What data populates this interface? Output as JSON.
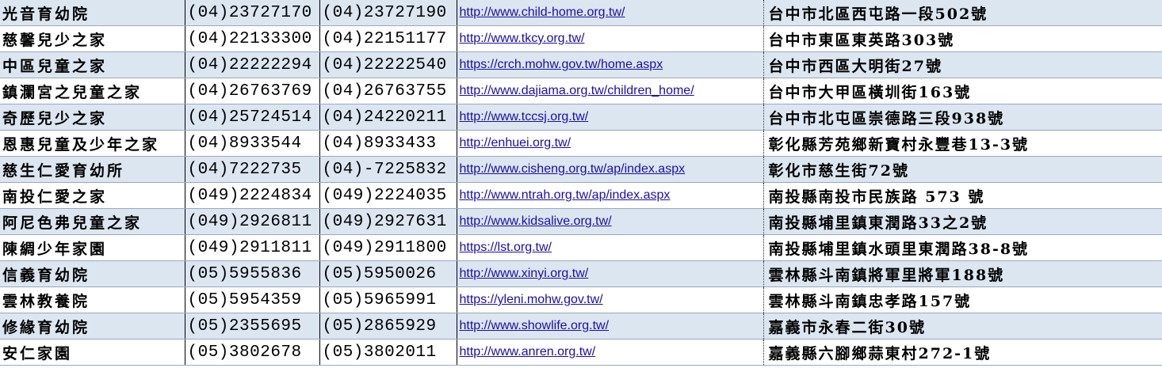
{
  "rows": [
    {
      "name": "光音育幼院",
      "tel": "(04)23727170",
      "fax": "(04)23727190",
      "url": "http://www.child-home.org.tw/",
      "address": "台中市北區西屯路一段502號"
    },
    {
      "name": "慈馨兒少之家",
      "tel": "(04)22133300",
      "fax": "(04)22151177",
      "url": "http://www.tkcy.org.tw/",
      "address": "台中市東區東英路303號"
    },
    {
      "name": "中區兒童之家",
      "tel": "(04)22222294",
      "fax": "(04)22222540",
      "url": "https://crch.mohw.gov.tw/home.aspx",
      "address": "台中市西區大明街27號"
    },
    {
      "name": "鎮瀾宮之兒童之家",
      "tel": "(04)26763769",
      "fax": "(04)26763755",
      "url": "http://www.dajiama.org.tw/children_home/",
      "address": "台中市大甲區橫圳街163號"
    },
    {
      "name": "奇歷兒少之家",
      "tel": "(04)25724514",
      "fax": "(04)24220211",
      "url": "http://www.tccsj.org.tw/",
      "address": "台中市北屯區崇德路三段938號"
    },
    {
      "name": "恩惠兒童及少年之家",
      "tel": "(04)8933544",
      "fax": "(04)8933433",
      "url": "http://enhuei.org.tw/",
      "address": "彰化縣芳苑鄉新寶村永豐巷13-3號"
    },
    {
      "name": "慈生仁愛育幼所",
      "tel": "(04)7222735",
      "fax": "(04)-7225832",
      "url": "http://www.cisheng.org.tw/ap/index.aspx",
      "address": "彰化市慈生街72號"
    },
    {
      "name": "南投仁愛之家",
      "tel": "(049)2224834",
      "fax": "(049)2224035",
      "url": "http://www.ntrah.org.tw/ap/index.aspx",
      "address": "南投縣南投市民族路 573 號"
    },
    {
      "name": "阿尼色弗兒童之家",
      "tel": "(049)2926811",
      "fax": "(049)2927631",
      "url": "http://www.kidsalive.org.tw/",
      "address": "南投縣埔里鎮東潤路33之2號"
    },
    {
      "name": "陳綢少年家園",
      "tel": "(049)2911811",
      "fax": "(049)2911800",
      "url": "https://lst.org.tw/",
      "address": "南投縣埔里鎮水頭里東潤路38-8號"
    },
    {
      "name": "信義育幼院",
      "tel": "(05)5955836",
      "fax": "(05)5950026",
      "url": "http://www.xinyi.org.tw/",
      "address": "雲林縣斗南鎮將軍里將軍188號"
    },
    {
      "name": "雲林教養院",
      "tel": "(05)5954359",
      "fax": "(05)5965991",
      "url": "https://yleni.mohw.gov.tw/",
      "address": "雲林縣斗南鎮忠孝路157號"
    },
    {
      "name": "修緣育幼院",
      "tel": "(05)2355695",
      "fax": "(05)2865929",
      "url": "http://www.showlife.org.tw/",
      "address": "嘉義市永春二街30號"
    },
    {
      "name": "安仁家園",
      "tel": "(05)3802678",
      "fax": "(05)3802011",
      "url": "http://www.anren.org.tw/",
      "address": "嘉義縣六腳鄉蒜東村272-1號"
    }
  ]
}
